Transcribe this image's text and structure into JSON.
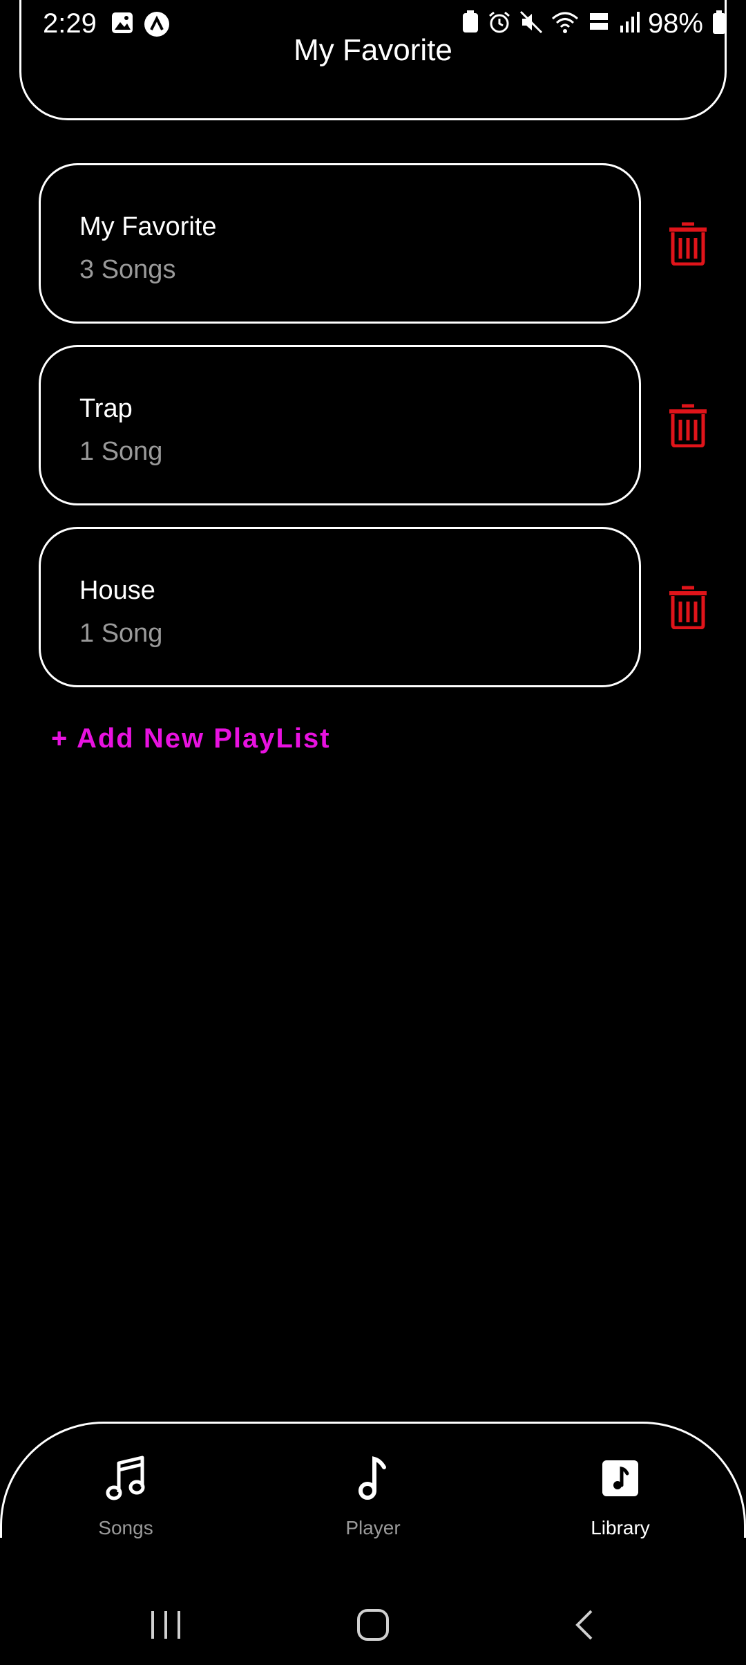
{
  "status_bar": {
    "time": "2:29",
    "battery": "98%"
  },
  "header": {
    "title": "My Favorite"
  },
  "playlists": [
    {
      "name": "My Favorite",
      "count": "3 Songs"
    },
    {
      "name": "Trap",
      "count": "1 Song"
    },
    {
      "name": "House",
      "count": "1 Song"
    }
  ],
  "add_playlist_label": "+ Add New PlayList",
  "bottom_nav": {
    "items": [
      {
        "label": "Songs",
        "icon": "music-notes-icon"
      },
      {
        "label": "Player",
        "icon": "music-note-icon"
      },
      {
        "label": "Library",
        "icon": "library-icon",
        "active": true
      }
    ]
  },
  "colors": {
    "accent": "#e812e0",
    "delete": "#e0141a",
    "muted_text": "#9a9a9a",
    "background": "#000000"
  }
}
